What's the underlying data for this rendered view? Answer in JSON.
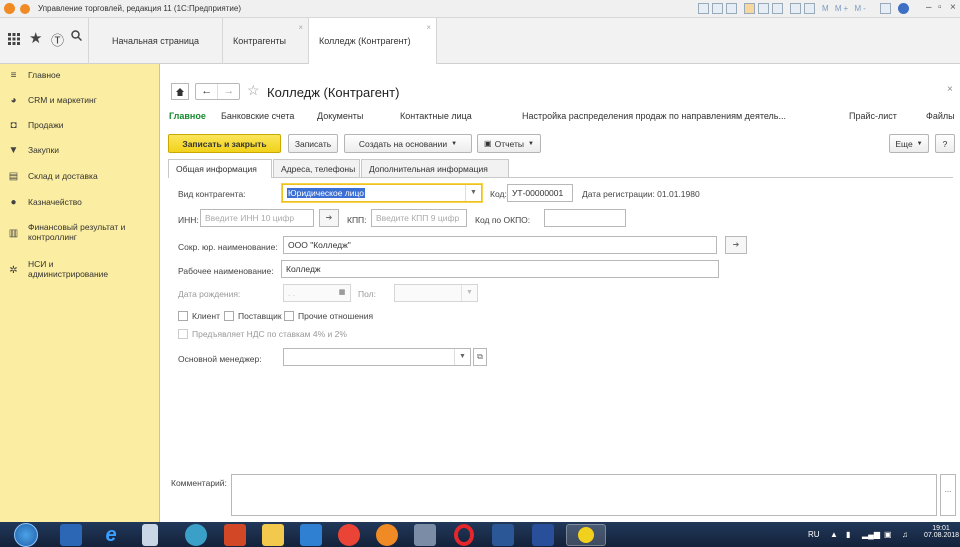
{
  "window": {
    "title": "Управление торговлей, редакция 11 (1С:Предприятие)"
  },
  "tabs": [
    {
      "label": "Начальная страница"
    },
    {
      "label": "Контрагенты"
    },
    {
      "label": "Колледж (Контрагент)"
    }
  ],
  "sidebar": {
    "items": [
      {
        "label": "Главное",
        "icon": "hamburger-icon"
      },
      {
        "label": "CRM и маркетинг",
        "icon": "pie-icon"
      },
      {
        "label": "Продажи",
        "icon": "bag-icon"
      },
      {
        "label": "Закупки",
        "icon": "cart-icon"
      },
      {
        "label": "Склад и доставка",
        "icon": "warehouse-icon"
      },
      {
        "label": "Казначейство",
        "icon": "coin-icon"
      },
      {
        "label": "Финансовый результат и контроллинг",
        "label_line1": "Финансовый результат и",
        "label_line2": "контроллинг",
        "icon": "chart-icon"
      },
      {
        "label": "НСИ и администрирование",
        "label_line1": "НСИ и",
        "label_line2": "администрирование",
        "icon": "gear-icon"
      }
    ]
  },
  "form": {
    "title": "Колледж (Контрагент)",
    "nav_links": [
      "Главное",
      "Банковские счета",
      "Документы",
      "Контактные лица",
      "Настройка распределения продаж по направлениям деятель...",
      "Прайс-лист",
      "Файлы"
    ],
    "toolbar": {
      "save_close": "Записать и закрыть",
      "save": "Записать",
      "create_based": "Создать на основании",
      "reports": "Отчеты",
      "more": "Еще",
      "help": "?"
    },
    "tabs": [
      "Общая информация",
      "Адреса, телефоны",
      "Дополнительная информация"
    ],
    "fields": {
      "kind_label": "Вид контрагента:",
      "kind_value": "Юридическое лицо",
      "code_label": "Код:",
      "code_value": "УТ-00000001",
      "reg_date": "Дата регистрации: 01.01.1980",
      "inn_label": "ИНН:",
      "inn_placeholder": "Введите ИНН 10 цифр",
      "kpp_label": "КПП:",
      "kpp_placeholder": "Введите КПП 9 цифр",
      "okpo_label": "Код по ОКПО:",
      "short_name_label": "Сокр. юр. наименование:",
      "short_name_value": "ООО \"Колледж\"",
      "work_name_label": "Рабочее наименование:",
      "work_name_value": "Колледж",
      "birth_label": "Дата рождения:",
      "birth_value": ". .",
      "gender_label": "Пол:",
      "client_label": "Клиент",
      "supplier_label": "Поставщик",
      "other_label": "Прочие отношения",
      "vat_label": "Предъявляет НДС по ставкам 4% и 2%",
      "manager_label": "Основной менеджер:",
      "comment_label": "Комментарий:",
      "comment_more": "..."
    }
  },
  "taskbar": {
    "lang": "RU",
    "time": "19:01",
    "date": "07.08.2018"
  },
  "colors": {
    "sidebar_bg": "#fbeda1",
    "primary_button": "#f4d923",
    "selection": "#3b6fd4",
    "nav_active": "#178a2e"
  }
}
